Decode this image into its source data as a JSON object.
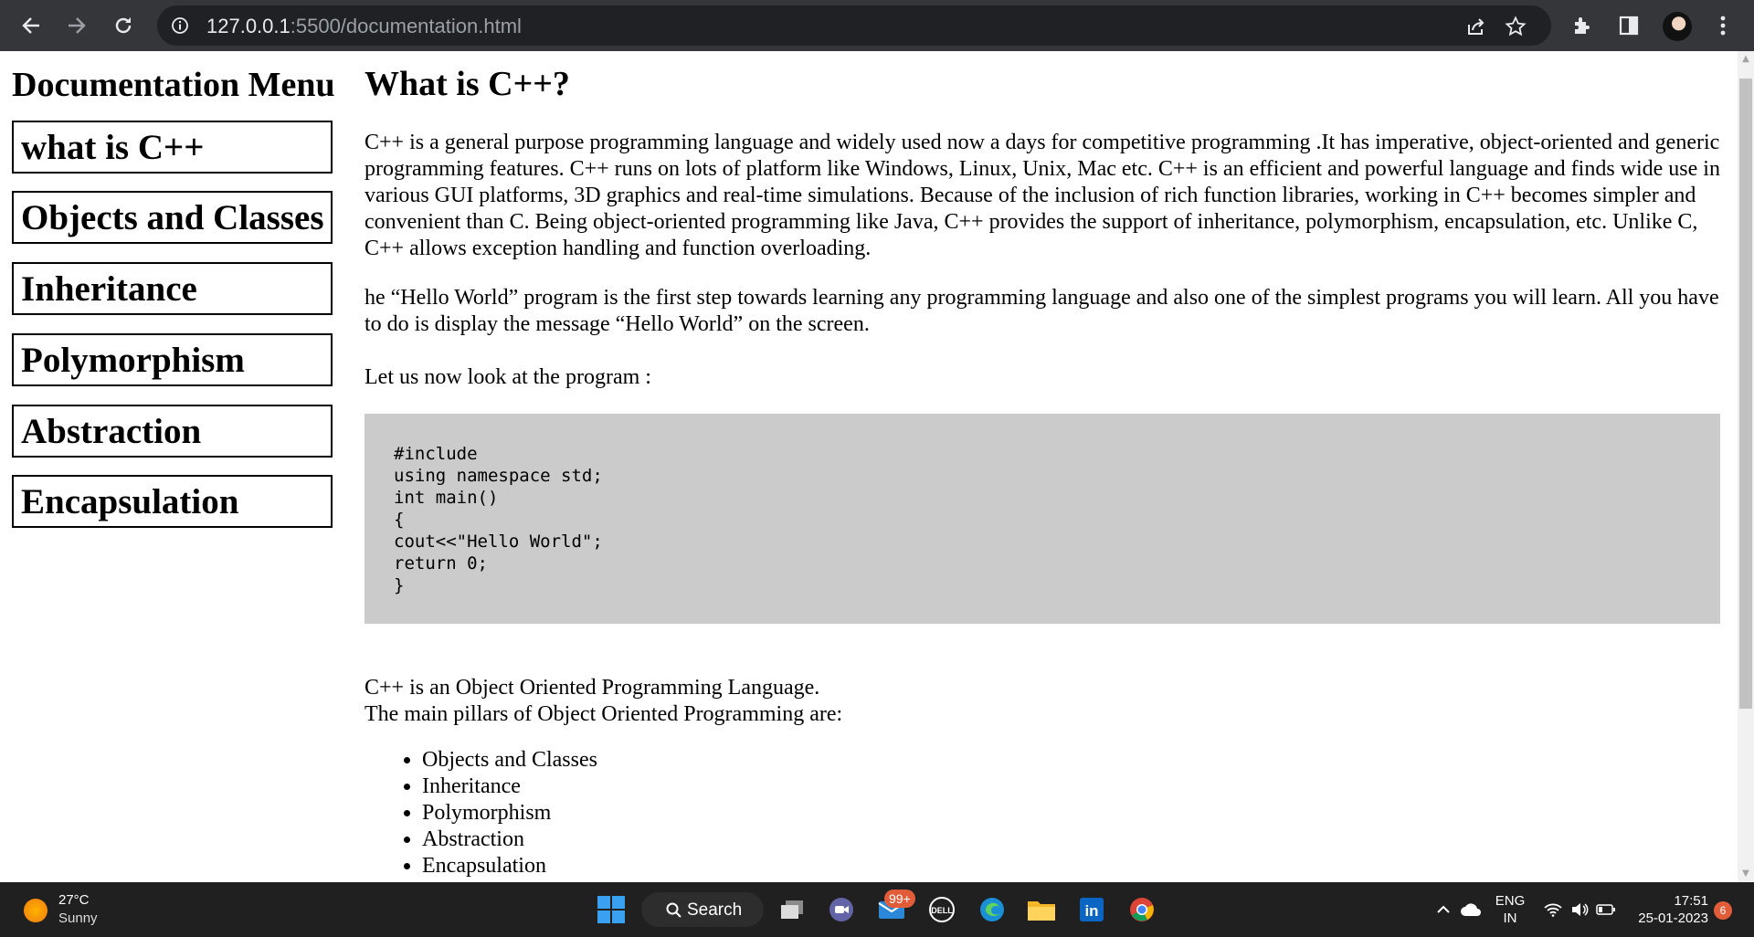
{
  "browser": {
    "url_host": "127.0.0.1",
    "url_rest": ":5500/documentation.html",
    "nav": [
      "back-icon",
      "forward-icon",
      "reload-icon"
    ],
    "omnibox_icons": [
      "share-icon",
      "star-icon"
    ],
    "toolbar_icons": [
      "extensions-icon",
      "side-panel-icon",
      "profile-avatar",
      "menu-icon"
    ]
  },
  "sidebar": {
    "title": "Documentation Menu",
    "items": [
      {
        "label": "what is C++"
      },
      {
        "label": "Objects and Classes"
      },
      {
        "label": "Inheritance"
      },
      {
        "label": "Polymorphism"
      },
      {
        "label": "Abstraction"
      },
      {
        "label": "Encapsulation"
      }
    ]
  },
  "main": {
    "heading": "What is C++?",
    "paragraph1": "C++ is a general purpose programming language and widely used now a days for competitive programming .It has imperative, object-oriented and generic programming features. C++ runs on lots of platform like Windows, Linux, Unix, Mac etc. C++ is an efficient and powerful language and finds wide use in various GUI platforms, 3D graphics and real-time simulations. Because of the inclusion of rich function libraries, working in C++ becomes simpler and convenient than C. Being object-oriented programming like Java, C++ provides the support of inheritance, polymorphism, encapsulation, etc. Unlike C, C++ allows exception handling and function overloading.",
    "paragraph2": "he “Hello World” program is the first step towards learning any programming language and also one of the simplest programs you will learn. All you have to do is display the message “Hello World” on the screen.",
    "paragraph3": "Let us now look at the program :",
    "code": "#include\nusing namespace std;\nint main()\n{\ncout<<\"Hello World\";\nreturn 0;\n}",
    "oop_line1": "C++ is an Object Oriented Programming Language.",
    "oop_line2": "The main pillars of Object Oriented Programming are:",
    "pillars": [
      "Objects and Classes",
      "Inheritance",
      "Polymorphism",
      "Abstraction",
      "Encapsulation"
    ]
  },
  "taskbar": {
    "weather_temp": "27°C",
    "weather_desc": "Sunny",
    "search_label": "Search",
    "mail_badge": "99+",
    "lang_line1": "ENG",
    "lang_line2": "IN",
    "time": "17:51",
    "date": "25-01-2023",
    "notification_count": "6"
  },
  "colors": {
    "toolbar_bg": "#35363a",
    "omnibox_bg": "#202124",
    "code_bg": "#cbcbcb",
    "taskbar_bg": "#202020",
    "badge": "#e15d3a"
  }
}
